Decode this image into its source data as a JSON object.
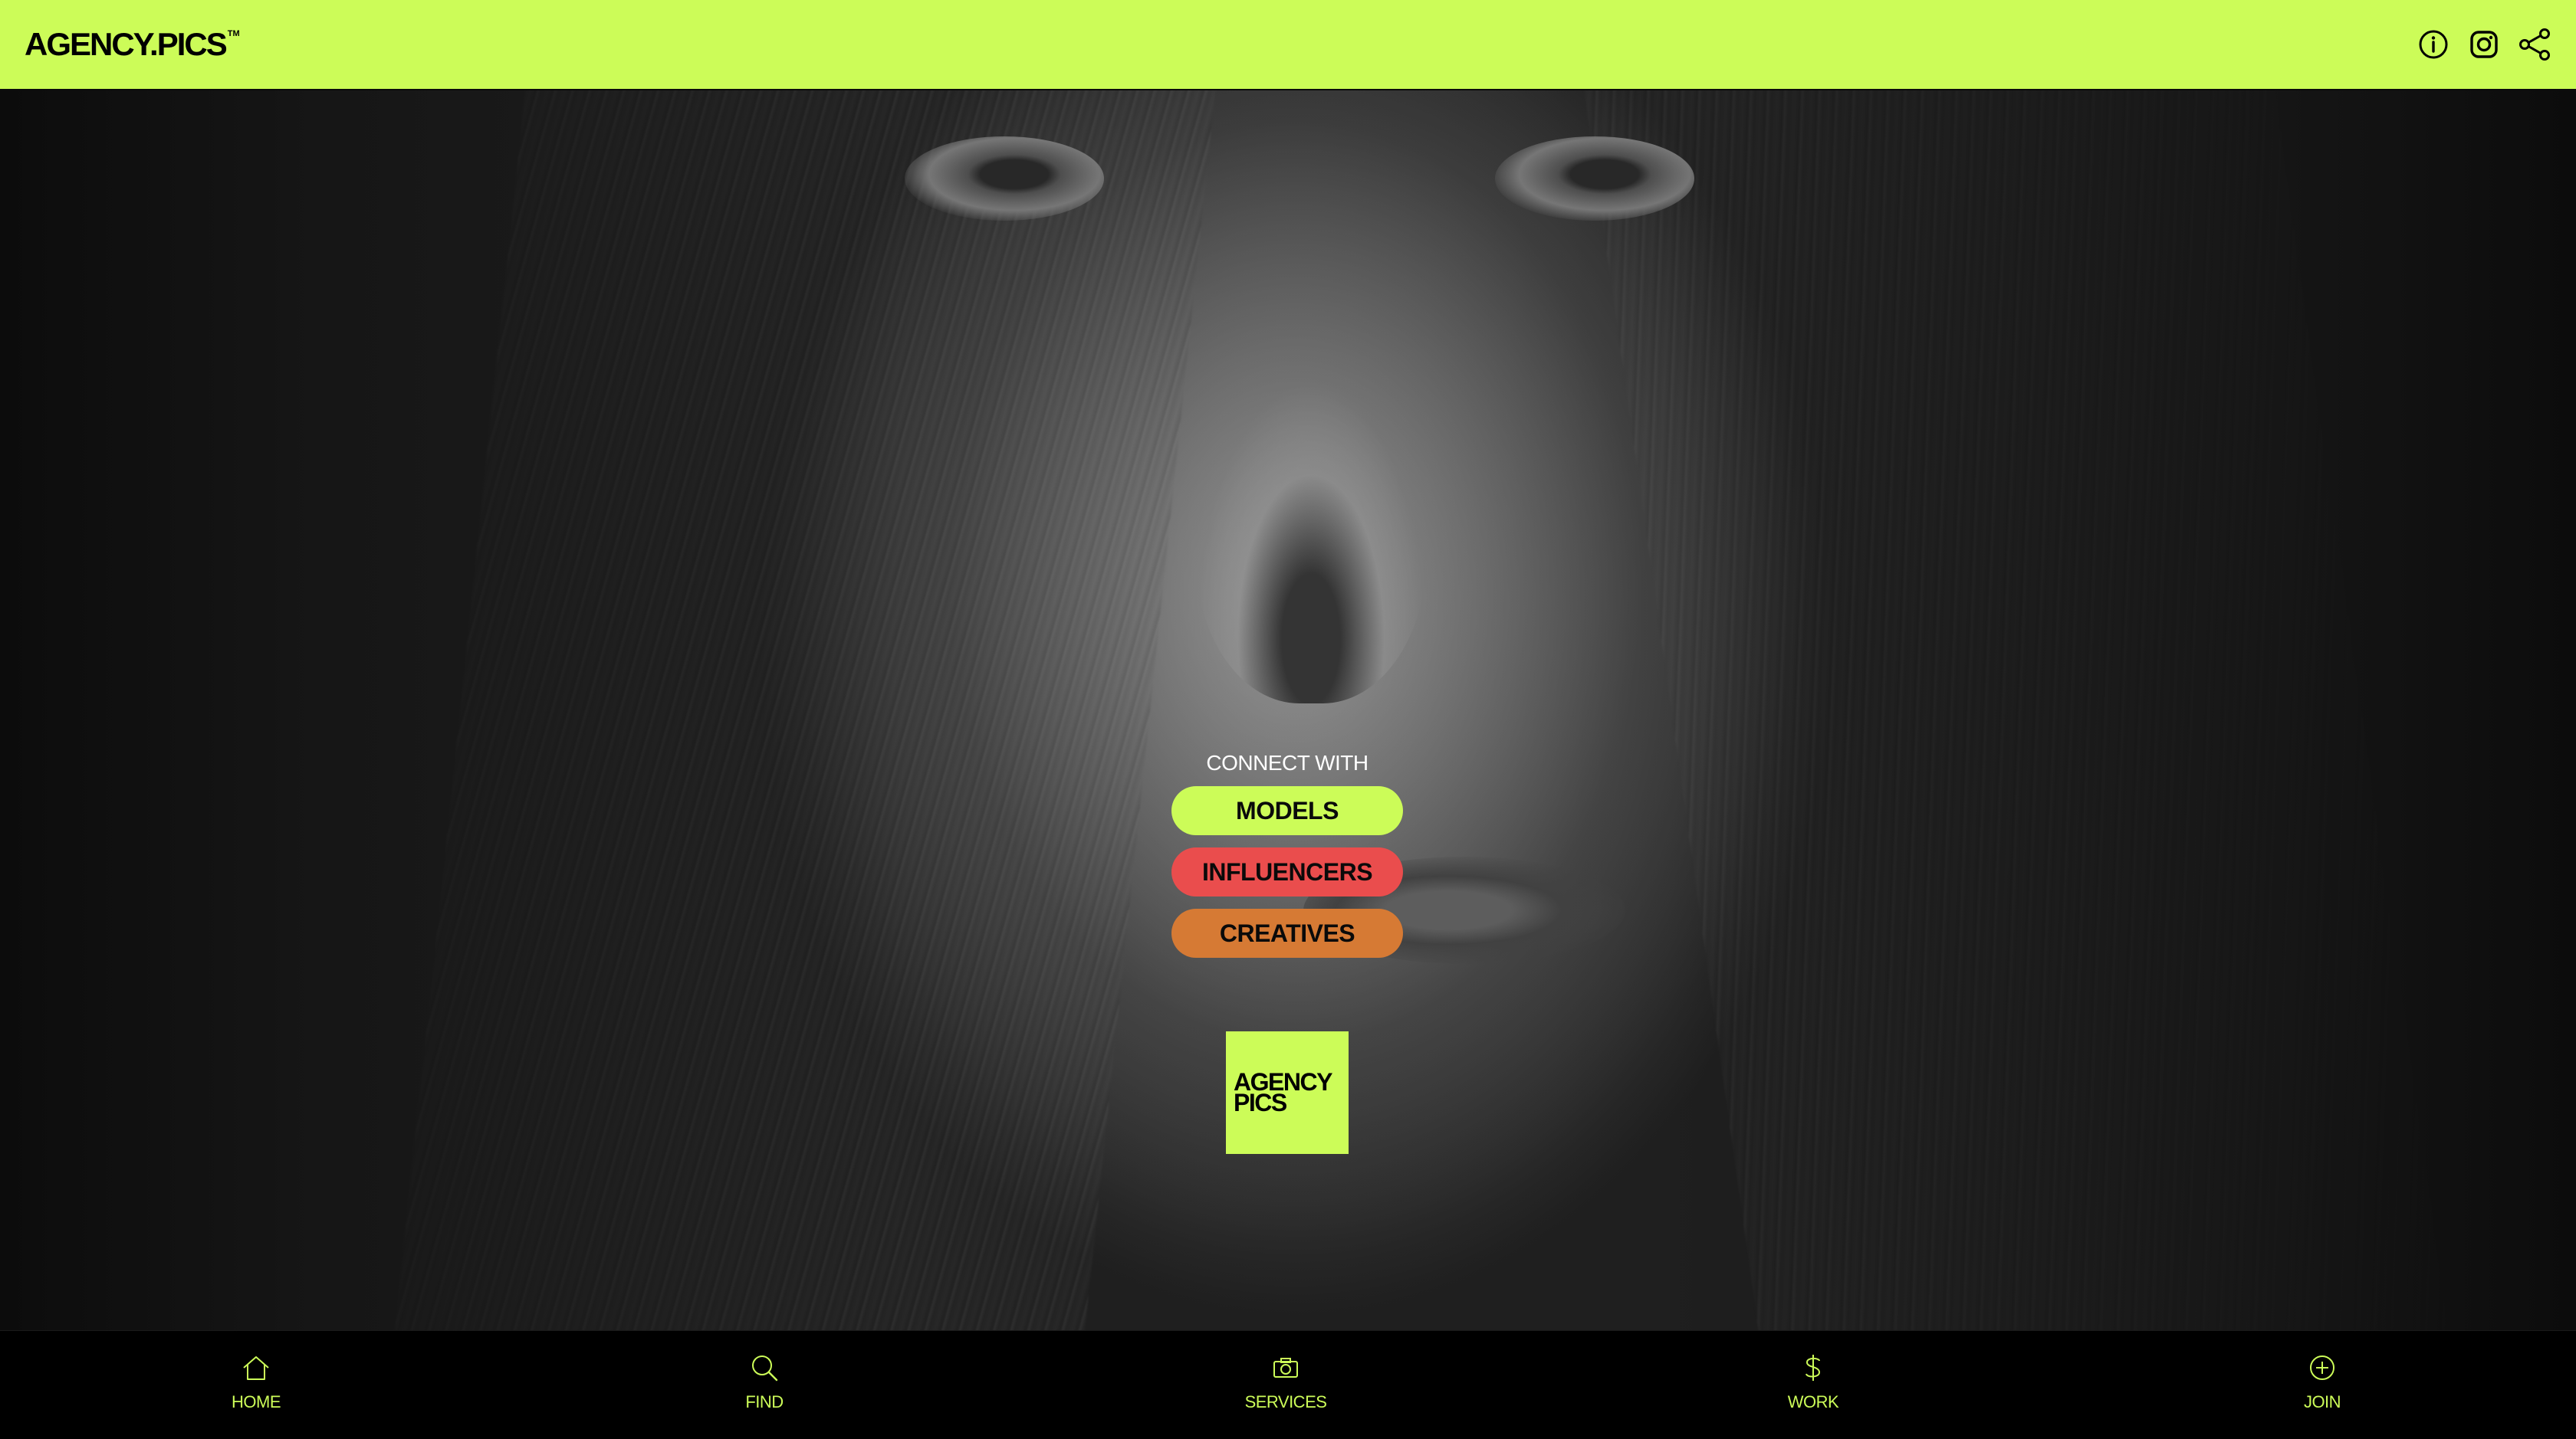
{
  "header": {
    "logo": "AGENCY.PICS",
    "logo_tm": "TM",
    "icons": [
      "info-icon",
      "instagram-icon",
      "share-icon"
    ]
  },
  "hero": {
    "connect_label": "CONNECT WITH",
    "buttons": [
      {
        "label": "MODELS",
        "color": "#ccfc58"
      },
      {
        "label": "INFLUENCERS",
        "color": "#ea4d4d"
      },
      {
        "label": "CREATIVES",
        "color": "#d67a34"
      }
    ],
    "badge_line1": "AGENCY",
    "badge_line2": "PICS"
  },
  "bottom_nav": {
    "items": [
      {
        "label": "HOME",
        "icon": "home-icon"
      },
      {
        "label": "FIND",
        "icon": "search-icon"
      },
      {
        "label": "SERVICES",
        "icon": "camera-icon"
      },
      {
        "label": "WORK",
        "icon": "dollar-icon"
      },
      {
        "label": "JOIN",
        "icon": "plus-circle-icon"
      }
    ]
  },
  "colors": {
    "accent": "#ccfc58",
    "influencers": "#ea4d4d",
    "creatives": "#d67a34",
    "nav_bg": "#000000"
  }
}
